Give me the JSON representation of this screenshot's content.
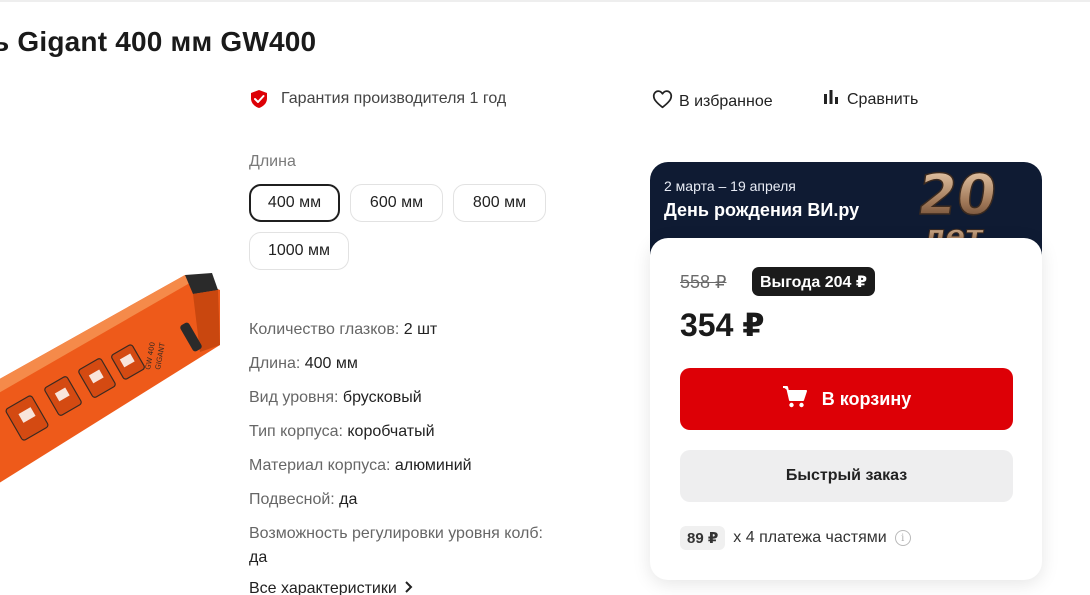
{
  "product": {
    "title": "ь Gigant 400 мм GW400"
  },
  "guarantee": {
    "text": "Гарантия производителя 1 год",
    "icon": "shield-check-icon",
    "icon_color": "#dd0006"
  },
  "actions": {
    "favorite_label": "В избранное",
    "compare_label": "Сравнить"
  },
  "length_selector": {
    "label": "Длина",
    "options": [
      "400 мм",
      "600 мм",
      "800 мм",
      "1000 мм"
    ],
    "selected": "400 мм"
  },
  "specs": [
    {
      "name": "Количество глазков:",
      "value": "2 шт"
    },
    {
      "name": "Длина:",
      "value": "400 мм"
    },
    {
      "name": "Вид уровня:",
      "value": "брусковый"
    },
    {
      "name": "Тип корпуса:",
      "value": "коробчатый"
    },
    {
      "name": "Материал корпуса:",
      "value": "алюминий"
    },
    {
      "name": "Подвесной:",
      "value": "да"
    },
    {
      "name": "Возможность регулировки уровня колб:",
      "value": "да"
    }
  ],
  "all_specs_link": "Все характеристики",
  "promo": {
    "dates": "2 марта – 19 апреля",
    "title": "День рождения ВИ.ру",
    "badge_number": "20",
    "badge_word": "лет"
  },
  "pricing": {
    "old_price": "558 ₽",
    "benefit": "Выгода 204 ₽",
    "price": "354 ₽",
    "cart_button": "В корзину",
    "quick_order_button": "Быстрый заказ",
    "installment_amount": "89 ₽",
    "installment_text": "x 4 платежа частями",
    "accent_color": "#dd0006"
  }
}
